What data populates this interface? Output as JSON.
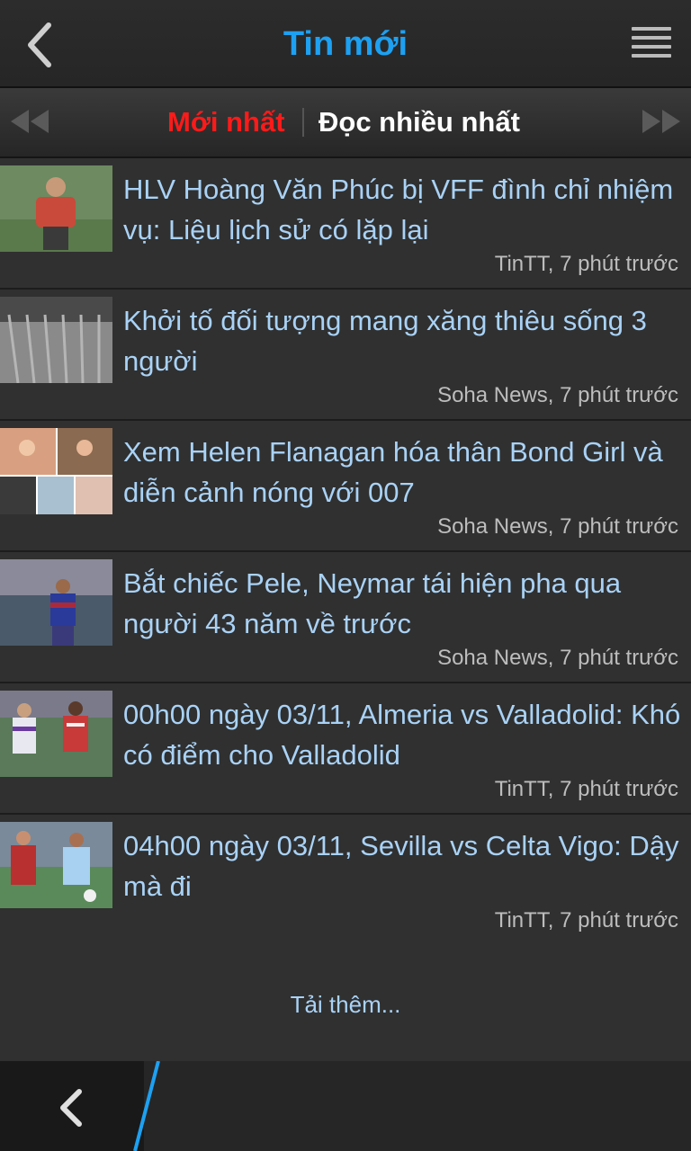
{
  "header": {
    "title": "Tin mới"
  },
  "tabs": {
    "newest": "Mới nhất",
    "most_read": "Đọc nhiều nhất"
  },
  "colors": {
    "title": "#1da1f2",
    "active_tab": "#ff1a1a",
    "headline": "#a9d2f6"
  },
  "articles": [
    {
      "title": "HLV Hoàng Văn Phúc bị VFF đình chỉ nhiệm vụ: Liệu lịch sử có lặp lại",
      "meta": "TinTT, 7 phút trước"
    },
    {
      "title": "Khởi tố đối tượng mang xăng thiêu sống 3 người",
      "meta": "Soha News, 7 phút trước"
    },
    {
      "title": "Xem Helen Flanagan hóa thân Bond Girl và diễn cảnh nóng với 007",
      "meta": "Soha News, 7 phút trước"
    },
    {
      "title": "Bắt chiếc Pele, Neymar tái hiện pha qua người 43 năm về trước",
      "meta": "Soha News, 7 phút trước"
    },
    {
      "title": "00h00 ngày 03/11, Almeria vs Valladolid: Khó có điểm cho Valladolid",
      "meta": "TinTT, 7 phút trước"
    },
    {
      "title": "04h00 ngày 03/11, Sevilla vs Celta Vigo: Dậy mà đi",
      "meta": "TinTT, 7 phút trước"
    }
  ],
  "load_more": "Tải thêm..."
}
